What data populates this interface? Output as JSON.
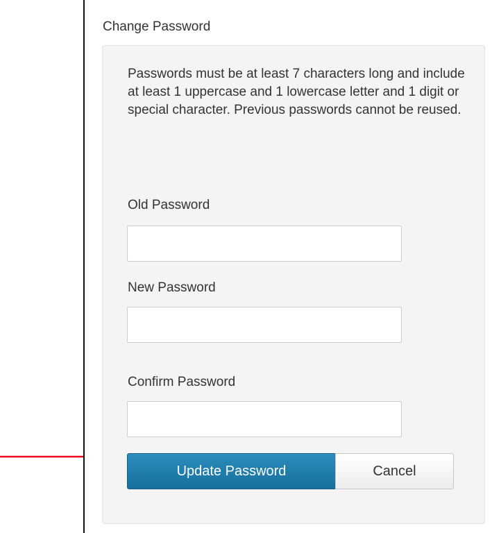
{
  "panel": {
    "title": "Change Password",
    "help_text": "Passwords must be at least 7 characters long and include at least 1 uppercase and 1 lowercase letter and 1 digit or special character. Previous passwords cannot be reused."
  },
  "fields": {
    "old_password": {
      "label": "Old Password",
      "value": "",
      "placeholder": ""
    },
    "new_password": {
      "label": "New Password",
      "value": "",
      "placeholder": ""
    },
    "confirm_password": {
      "label": "Confirm Password",
      "value": "",
      "placeholder": ""
    }
  },
  "buttons": {
    "update_label": "Update Password",
    "cancel_label": "Cancel"
  },
  "colors": {
    "primary_button": "#1a7aab",
    "annotation_arrow": "#e8001c",
    "panel_background": "#f4f4f4"
  },
  "annotations": {
    "arrow_icon": "arrow-right-icon"
  }
}
